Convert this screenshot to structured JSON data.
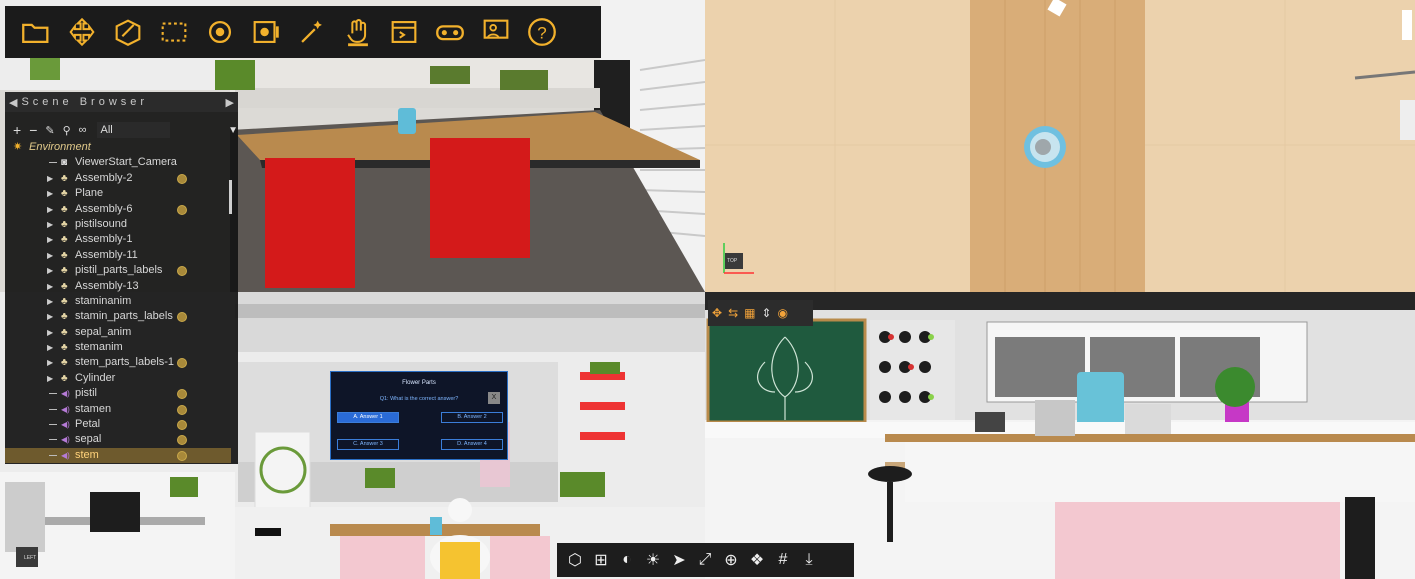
{
  "toolbar": {
    "icons": [
      "open-folder-icon",
      "move-icon",
      "edit-cube-icon",
      "select-rect-icon",
      "orbit-camera-icon",
      "record-icon",
      "magic-wand-icon",
      "pick-hand-icon",
      "layout-panel-icon",
      "vr-headset-icon",
      "presenter-icon",
      "help-icon"
    ],
    "accent": "#f2b12c"
  },
  "scene_browser": {
    "title": "Scene Browser",
    "filter_value": "All",
    "tools": [
      "add-icon",
      "remove-icon",
      "eraser-icon",
      "search-icon",
      "binoculars-icon"
    ],
    "tree": [
      {
        "label": "Environment",
        "type": "root",
        "expand": false,
        "badge": false
      },
      {
        "label": "ViewerStart_Camera",
        "type": "camera",
        "expand": false,
        "badge": false
      },
      {
        "label": "Assembly-2",
        "type": "assembly",
        "expand": true,
        "badge": true
      },
      {
        "label": "Plane",
        "type": "assembly",
        "expand": true,
        "badge": false
      },
      {
        "label": "Assembly-6",
        "type": "assembly",
        "expand": true,
        "badge": true
      },
      {
        "label": "pistilsound",
        "type": "assembly",
        "expand": true,
        "badge": false
      },
      {
        "label": "Assembly-1",
        "type": "assembly",
        "expand": true,
        "badge": false
      },
      {
        "label": "Assembly-11",
        "type": "assembly",
        "expand": true,
        "badge": false
      },
      {
        "label": "pistil_parts_labels",
        "type": "assembly",
        "expand": true,
        "badge": true
      },
      {
        "label": "Assembly-13",
        "type": "assembly",
        "expand": true,
        "badge": false
      },
      {
        "label": "staminanim",
        "type": "assembly",
        "expand": true,
        "badge": false
      },
      {
        "label": "stamin_parts_labels",
        "type": "assembly",
        "expand": true,
        "badge": true
      },
      {
        "label": "sepal_anim",
        "type": "assembly",
        "expand": true,
        "badge": false
      },
      {
        "label": "stemanim",
        "type": "assembly",
        "expand": true,
        "badge": false
      },
      {
        "label": "stem_parts_labels-1",
        "type": "assembly",
        "expand": true,
        "badge": true
      },
      {
        "label": "Cylinder",
        "type": "assembly",
        "expand": true,
        "badge": false
      },
      {
        "label": "pistil",
        "type": "sound",
        "expand": false,
        "badge": true
      },
      {
        "label": "stamen",
        "type": "sound",
        "expand": false,
        "badge": true
      },
      {
        "label": "Petal",
        "type": "sound",
        "expand": false,
        "badge": true
      },
      {
        "label": "sepal",
        "type": "sound",
        "expand": false,
        "badge": true
      },
      {
        "label": "stem",
        "type": "sound",
        "expand": false,
        "badge": true,
        "selected": true
      }
    ]
  },
  "quiz": {
    "title": "Flower Parts",
    "question": "Q1: What is the correct answer?",
    "answers": [
      "A. Answer 1",
      "B. Answer 2",
      "C. Answer 3",
      "D. Answer 4"
    ],
    "close": "X"
  },
  "viewports": {
    "top_right_label": "TOP",
    "bottom_left_label": "LEFT"
  },
  "bottom_toolbar": {
    "icons": [
      "view-cube-icon",
      "layout-grid-icon",
      "shading-icon",
      "light-icon",
      "pointer-icon",
      "fit-view-icon",
      "zoom-icon",
      "render-icon",
      "grid-icon",
      "download-icon"
    ]
  }
}
